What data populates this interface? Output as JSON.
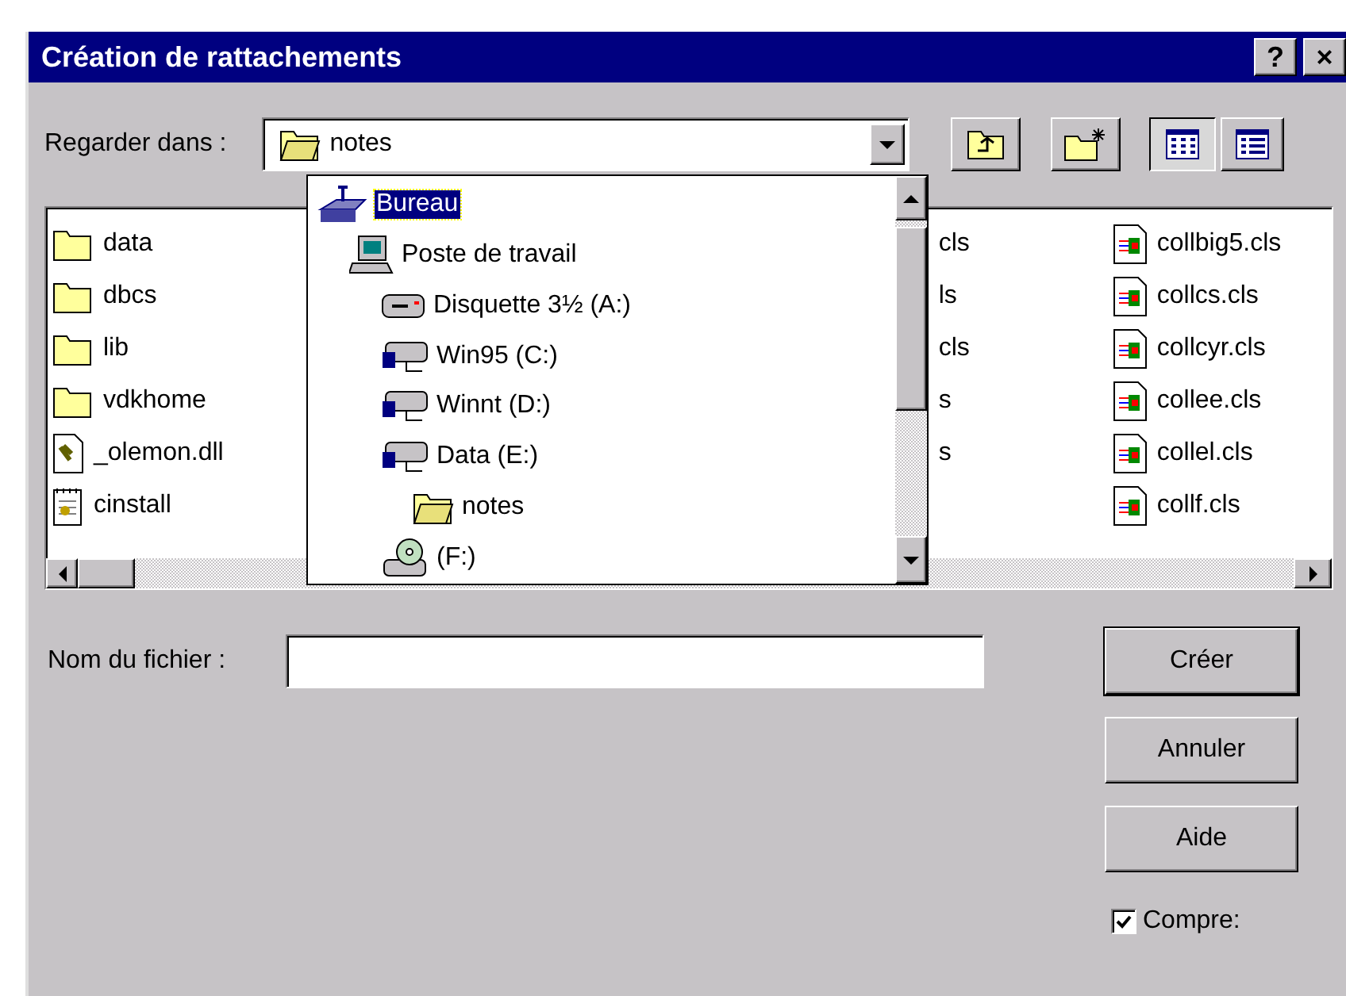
{
  "window": {
    "title": "Création de rattachements",
    "help_button": "?",
    "close_button": "×"
  },
  "look_in": {
    "label": "Regarder dans :",
    "value": "notes"
  },
  "toolbar": [
    {
      "kind": "up"
    },
    {
      "kind": "new-folder"
    }
  ],
  "view_buttons": [
    {
      "kind": "list",
      "selected": true
    },
    {
      "kind": "details",
      "selected": false
    }
  ],
  "files": {
    "column_1": [
      {
        "name": "data",
        "kind": "folder"
      },
      {
        "name": "dbcs",
        "kind": "folder"
      },
      {
        "name": "lib",
        "kind": "folder"
      },
      {
        "name": "vdkhome",
        "kind": "folder"
      },
      {
        "name": "_olemon.dll",
        "kind": "dll"
      },
      {
        "name": "cinstall",
        "kind": "config"
      }
    ],
    "column_2": [
      "cls",
      "ls",
      "cls",
      "s",
      "s"
    ],
    "column_3": [
      {
        "name": "collbig5.cls",
        "kind": "cls"
      },
      {
        "name": "collcs.cls",
        "kind": "cls"
      },
      {
        "name": "collcyr.cls",
        "kind": "cls"
      },
      {
        "name": "collee.cls",
        "kind": "cls"
      },
      {
        "name": "collel.cls",
        "kind": "cls"
      },
      {
        "name": "collf.cls",
        "kind": "cls"
      }
    ]
  },
  "dropdown": [
    {
      "label": "Bureau",
      "kind": "desktop",
      "selected": true,
      "children": [
        {
          "label": "Poste de travail",
          "kind": "computer",
          "selected": false,
          "children": [
            {
              "label": "Disquette 3½ (A:)",
              "kind": "floppy",
              "selected": false
            },
            {
              "label": "Win95 (C:)",
              "kind": "drive",
              "selected": false
            },
            {
              "label": "Winnt (D:)",
              "kind": "drive",
              "selected": false
            },
            {
              "label": "Data (E:)",
              "kind": "drive",
              "selected": false,
              "children": [
                {
                  "label": "notes",
                  "kind": "open-folder",
                  "selected": false
                }
              ]
            },
            {
              "label": "(F:)",
              "kind": "cdrom",
              "selected": false
            }
          ]
        }
      ]
    }
  ],
  "file_name": {
    "label": "Nom du fichier :"
  },
  "buttons": [
    {
      "label": "Créer",
      "default": true
    },
    {
      "label": "Annuler",
      "default": false
    },
    {
      "label": "Aide",
      "default": false
    }
  ],
  "compress": {
    "label": "Compre:",
    "checked": true
  }
}
